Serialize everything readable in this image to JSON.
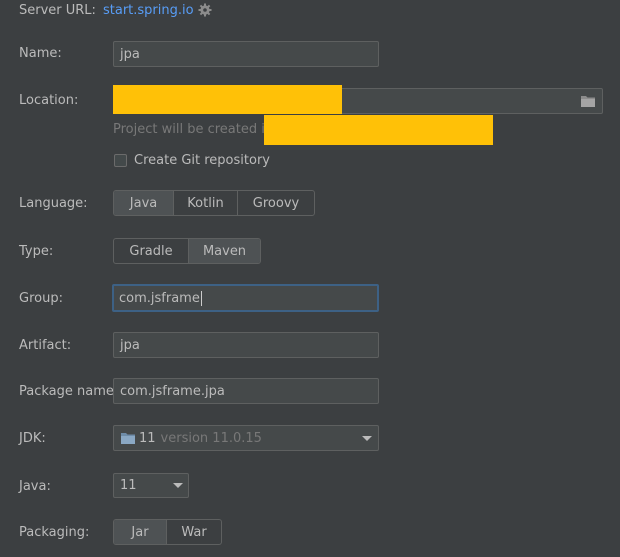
{
  "server": {
    "label": "Server URL:",
    "url": "start.spring.io",
    "settings_icon": "gear-icon"
  },
  "name": {
    "label": "Name:",
    "value": "jpa"
  },
  "location": {
    "label": "Location:",
    "value": "",
    "browse_icon": "folder-icon",
    "hint": "Project will be created in:"
  },
  "git": {
    "label": "Create Git repository",
    "checked": false
  },
  "language": {
    "label": "Language:",
    "options": [
      "Java",
      "Kotlin",
      "Groovy"
    ],
    "selected": "Java"
  },
  "type": {
    "label": "Type:",
    "options": [
      "Gradle",
      "Maven"
    ],
    "selected": "Maven"
  },
  "group": {
    "label": "Group:",
    "value": "com.jsframe"
  },
  "artifact": {
    "label": "Artifact:",
    "value": "jpa"
  },
  "package_name": {
    "label": "Package name:",
    "value": "com.jsframe.jpa"
  },
  "jdk": {
    "label": "JDK:",
    "version": "11",
    "detail": "version 11.0.15",
    "icon": "folder-icon"
  },
  "java": {
    "label": "Java:",
    "value": "11"
  },
  "packaging": {
    "label": "Packaging:",
    "options": [
      "Jar",
      "War"
    ],
    "selected": "Jar"
  },
  "colors": {
    "background": "#3c3f41",
    "field_bg": "#45494a",
    "link": "#589df6",
    "focus": "#3d6185",
    "redaction": "#ffc107"
  }
}
